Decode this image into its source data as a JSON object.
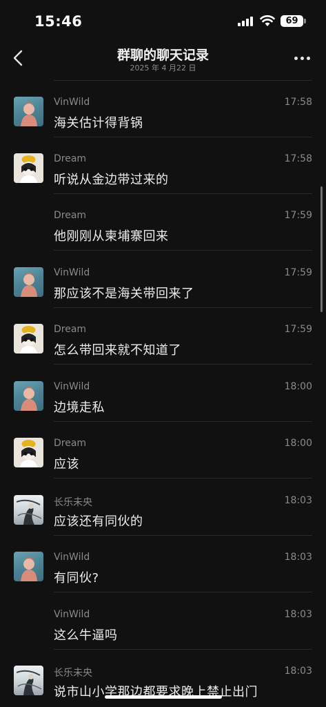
{
  "status_bar": {
    "time": "15:46",
    "battery": "69"
  },
  "header": {
    "title": "群聊的聊天记录",
    "subtitle": "2025 年 4 月22 日"
  },
  "messages": [
    {
      "sender": "VinWild",
      "time": "17:58",
      "text": "海关估计得背锅",
      "avatar": "vinwild-avatar"
    },
    {
      "sender": "Dream",
      "time": "17:58",
      "text": "听说从金边带过来的",
      "avatar": "dream-avatar"
    },
    {
      "sender": "Dream",
      "time": "17:59",
      "text": "他刚刚从柬埔寨回来",
      "avatar": ""
    },
    {
      "sender": "VinWild",
      "time": "17:59",
      "text": "那应该不是海关带回来了",
      "avatar": "vinwild-avatar"
    },
    {
      "sender": "Dream",
      "time": "17:59",
      "text": "怎么带回来就不知道了",
      "avatar": "dream-avatar"
    },
    {
      "sender": "VinWild",
      "time": "18:00",
      "text": "边境走私",
      "avatar": "vinwild-avatar"
    },
    {
      "sender": "Dream",
      "time": "18:00",
      "text": "应该",
      "avatar": "dream-avatar"
    },
    {
      "sender": "长乐未央",
      "time": "18:03",
      "text": "应该还有同伙的",
      "avatar": "changle-avatar"
    },
    {
      "sender": "VinWild",
      "time": "18:03",
      "text": "有同伙?",
      "avatar": "vinwild-avatar"
    },
    {
      "sender": "VinWild",
      "time": "18:03",
      "text": "这么牛逼吗",
      "avatar": ""
    },
    {
      "sender": "长乐未央",
      "time": "18:03",
      "text": "说市山小学那边都要求晚上禁止出门",
      "avatar": "changle-avatar"
    }
  ],
  "icons": {
    "back": "chevron-left-icon",
    "more": "more-dots-icon",
    "signal": "signal-icon",
    "wifi": "wifi-icon"
  },
  "colors": {
    "background": "#111111",
    "text": "#ececec",
    "meta": "#8a8a8a",
    "divider": "#2a2a2a"
  }
}
